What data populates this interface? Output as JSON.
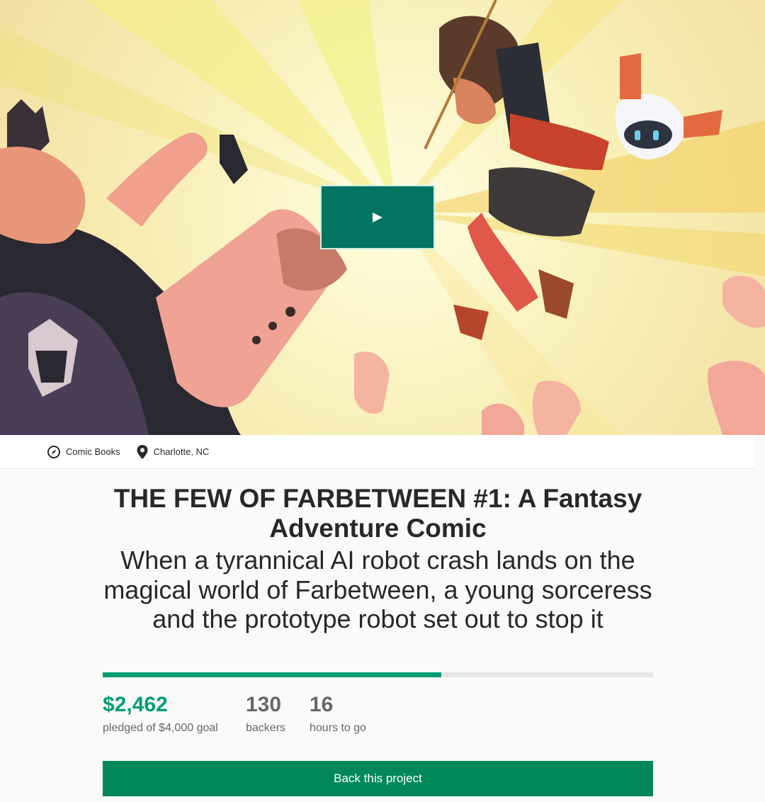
{
  "hero": {
    "alt": "Comic cover art: a young sorceress and a small robot falling through a burst of light toward a giant robot",
    "play_icon": "play-icon"
  },
  "meta": {
    "category_icon": "compass-icon",
    "category": "Comic Books",
    "location_icon": "location-pin-icon",
    "location": "Charlotte, NC"
  },
  "project": {
    "title": "THE FEW OF FARBETWEEN #1: A Fantasy Adventure Comic",
    "blurb": "When a tyrannical AI robot crash lands on the magical world of Farbetween, a young sorceress and the prototype robot set out to stop it"
  },
  "funding": {
    "progress_percent": 61.55,
    "pledged": "$2,462",
    "pledged_caption": "pledged of $4,000 goal",
    "backers": "130",
    "backers_caption": "backers",
    "time_left": "16",
    "time_left_caption": "hours to go"
  },
  "cta": {
    "back_label": "Back this project"
  },
  "colors": {
    "accent": "#009e74",
    "button": "#028858",
    "play_button": "#037362",
    "text": "#282828",
    "muted": "#656969"
  }
}
